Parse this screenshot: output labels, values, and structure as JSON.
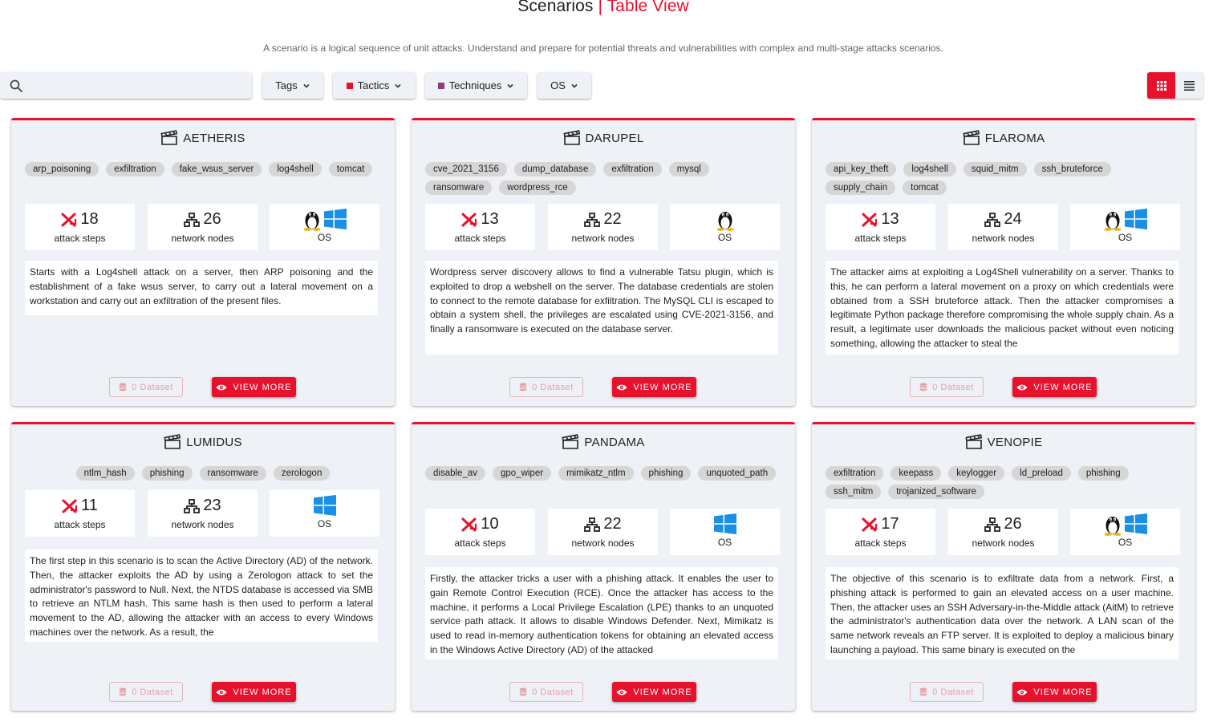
{
  "header": {
    "title": "Scenarios",
    "separator": "|",
    "title_accent": "Table View",
    "subtitle": "A scenario is a logical sequence of unit attacks. Understand and prepare for potential threats and vulnerabilities with complex and multi-stage attacks scenarios."
  },
  "toolbar": {
    "search_value": "",
    "filters": {
      "tags": "Tags",
      "tactics": "Tactics",
      "techniques": "Techniques",
      "os": "OS"
    },
    "colors": {
      "tactics": "#e8112d",
      "techniques": "#8e3a7c"
    }
  },
  "labels": {
    "attack_steps": "attack steps",
    "network_nodes": "network nodes",
    "os": "OS",
    "dataset": "0 Dataset",
    "view_more": "VIEW MORE"
  },
  "colors": {
    "accent": "#e8112d",
    "card_bg": "#eef1f5"
  },
  "cards": [
    {
      "name": "AETHERIS",
      "tags": [
        "arp_poisoning",
        "exfiltration",
        "fake_wsus_server",
        "log4shell",
        "tomcat"
      ],
      "attack_steps": "18",
      "network_nodes": "26",
      "os": [
        "linux",
        "windows"
      ],
      "description": "Starts with a Log4shell attack on a server, then ARP poisoning and the establishment of a fake wsus server, to carry out a lateral movement on a workstation and carry out an exfiltration of the present files."
    },
    {
      "name": "DARUPEL",
      "tags": [
        "cve_2021_3156",
        "dump_database",
        "exfiltration",
        "mysql",
        "ransomware",
        "wordpress_rce"
      ],
      "attack_steps": "13",
      "network_nodes": "22",
      "os": [
        "linux"
      ],
      "description": "Wordpress server discovery allows to find a vulnerable Tatsu plugin, which is exploited to drop a webshell on the server. The database credentials are stolen to connect to the remote database for exfiltration. The MySQL CLI is escaped to obtain a system shell, the privileges are escalated using CVE-2021-3156, and finally a ransomware is executed on the database server."
    },
    {
      "name": "FLAROMA",
      "tags": [
        "api_key_theft",
        "log4shell",
        "squid_mitm",
        "ssh_bruteforce",
        "supply_chain",
        "tomcat"
      ],
      "attack_steps": "13",
      "network_nodes": "24",
      "os": [
        "linux",
        "windows"
      ],
      "description": "The attacker aims at exploiting a Log4Shell vulnerability on a server. Thanks to this, he can perform a lateral movement on a proxy on which credentials were obtained from a SSH bruteforce attack. Then the attacker compromises a legitimate Python package therefore compromising the whole supply chain. As a result, a legitimate user downloads the malicious packet without even noticing something, allowing the attacker to steal the"
    },
    {
      "name": "LUMIDUS",
      "tags": [
        "ntlm_hash",
        "phishing",
        "ransomware",
        "zerologon"
      ],
      "attack_steps": "11",
      "network_nodes": "23",
      "os": [
        "windows"
      ],
      "description": "The first step in this scenario is to scan the Active Directory (AD) of the network. Then, the attacker exploits the AD by using a Zerologon attack to set the administrator's password to Null. Next, the NTDS database is accessed via SMB to retrieve an NTLM hash. This same hash is then used to perform a lateral movement to the AD, allowing the attacker with an access to every Windows machines over the network. As a result, the"
    },
    {
      "name": "PANDAMA",
      "tags": [
        "disable_av",
        "gpo_wiper",
        "mimikatz_ntlm",
        "phishing",
        "unquoted_path"
      ],
      "attack_steps": "10",
      "network_nodes": "22",
      "os": [
        "windows"
      ],
      "description": "Firstly, the attacker tricks a user with a phishing attack. It enables the user to gain Remote Control Execution (RCE). Once the attacker has access to the machine, it performs a Local Privilege Escalation (LPE) thanks to an unquoted service path attack. It allows to disable Windows Defender. Next, Mimikatz is used to read in-memory authentication tokens for obtaining an elevated access in the Windows Active Directory (AD) of the attacked"
    },
    {
      "name": "VENOPIE",
      "tags": [
        "exfiltration",
        "keepass",
        "keylogger",
        "ld_preload",
        "phishing",
        "ssh_mitm",
        "trojanized_software"
      ],
      "attack_steps": "17",
      "network_nodes": "26",
      "os": [
        "linux",
        "windows"
      ],
      "description": "The objective of this scenario is to exfiltrate data from a network. First, a phishing attack is performed to gain an elevated access on a user machine. Then, the attacker uses an SSH Adversary-in-the-Middle attack (AitM) to retrieve the administrator's authentication data over the network. A LAN scan of the same network reveals an FTP server. It is exploited to deploy a malicious binary launching a payload. This same binary is executed on the"
    }
  ]
}
